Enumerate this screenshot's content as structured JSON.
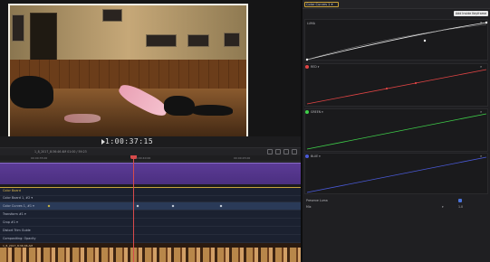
{
  "viewer": {
    "timecode": "1:00:37:15",
    "play_icon": "play-icon"
  },
  "timeline": {
    "toolbar_text": "1_8_2017_8:36:46 AM      01:00 / 59:23",
    "ruler_ticks": [
      "00:00:35:00",
      "00:00:40:00",
      "00:00:45:00"
    ],
    "effects_header": "Color Board",
    "effect_rows": [
      {
        "label": "Color Board 1, #2 ▾",
        "selected": false
      },
      {
        "label": "Color Curves 1, #1 ▾",
        "selected": true
      },
      {
        "label": "Transform #1 ▾",
        "selected": false
      },
      {
        "label": "Crop #1 ▾",
        "selected": false
      },
      {
        "label": "Distort Trim Guide",
        "selected": false
      },
      {
        "label": "Compositing: Opacity",
        "selected": false
      }
    ],
    "filmstrip_label": "1_8_2017_8:36:46 AM"
  },
  "inspector": {
    "title": "Color Curves 1 ▾",
    "tooltip": "Add Inside Keyframe",
    "curves": [
      {
        "name": "LUMA",
        "color": "#e8e8e8"
      },
      {
        "name": "RED ▾",
        "color": "#e04444"
      },
      {
        "name": "GREEN ▾",
        "color": "#3fcf4a"
      },
      {
        "name": "BLUE ▾",
        "color": "#4a5ad8"
      }
    ],
    "preserve_luma_label": "Preserve Luma",
    "mix_label": "Mix",
    "mix_value": "1.0"
  },
  "colors": {
    "accent": "#c9a23a",
    "clip_purple": "#5b3b95",
    "playhead": "#d84b4b"
  }
}
